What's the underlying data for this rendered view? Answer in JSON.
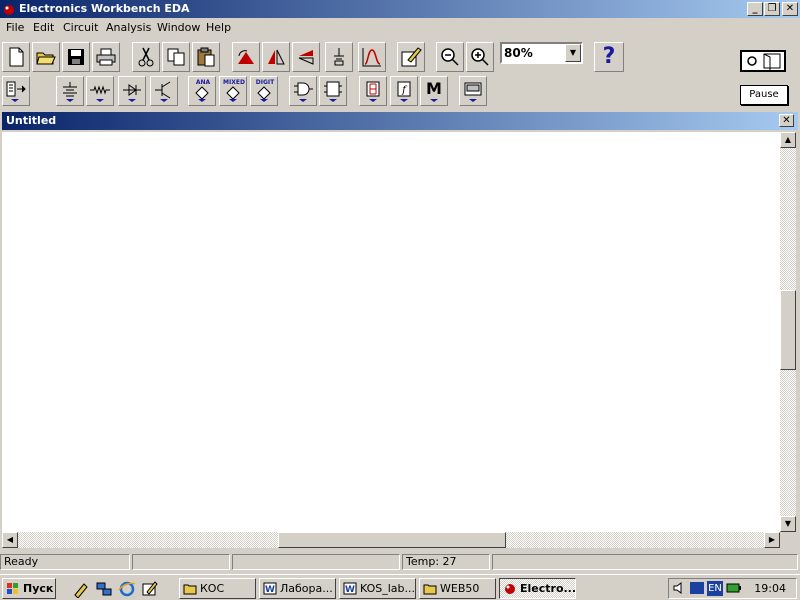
{
  "window": {
    "title": "Electronics Workbench EDA"
  },
  "menu": [
    "File",
    "Edit",
    "Circuit",
    "Analysis",
    "Window",
    "Help"
  ],
  "toolbar": {
    "zoom_value": "80%",
    "help_label": "?",
    "pause_label": "Pause",
    "parts_bins": {
      "analog": "ANA",
      "mixed": "MIXED",
      "digital": "DIGIT",
      "misc": "M"
    }
  },
  "document": {
    "title": "Untitled",
    "close_label": "✕"
  },
  "status": {
    "state": "Ready",
    "temp": "Temp:  27"
  },
  "taskbar": {
    "start_label": "Пуск",
    "tasks": [
      "КОС",
      "Лабора...",
      "KOS_lab...",
      "WEB50",
      "Electro..."
    ],
    "clock": "19:04",
    "lang": "EN"
  }
}
